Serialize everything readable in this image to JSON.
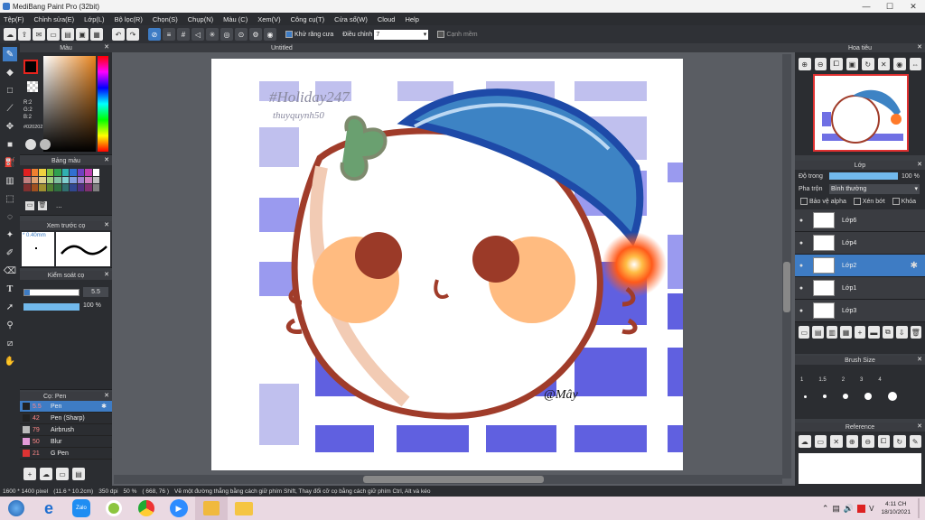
{
  "window": {
    "title": "MediBang Paint Pro (32bit)",
    "min": "—",
    "max": "☐",
    "close": "✕"
  },
  "menu": [
    "Tệp(F)",
    "Chỉnh sửa(E)",
    "Lớp(L)",
    "Bộ lọc(R)",
    "Chọn(S)",
    "Chụp(N)",
    "Màu (C)",
    "Xem(V)",
    "Công cụ(T)",
    "Cửa sổ(W)",
    "Cloud",
    "Help"
  ],
  "toolbar": {
    "antialias_label": "Khử răng cưa",
    "adjust_label": "Điều chỉnh",
    "adjust_value": "7",
    "edge_label": "Cạnh mềm"
  },
  "panels": {
    "color": {
      "title": "Màu",
      "r": "R:2",
      "g": "G:2",
      "b": "B:2",
      "hex": "#020202"
    },
    "palette": {
      "title": "Bảng màu",
      "more": "..."
    },
    "brush_preview": {
      "title": "Xem trước cọ",
      "size": "0.40mm"
    },
    "brush_control": {
      "title": "Kiểm soát cọ",
      "size": "5.5",
      "opacity": "100 %"
    },
    "brushes": {
      "title": "Cọ: Pen",
      "items": [
        {
          "size": "5.5",
          "name": "Pen",
          "color": "#222222"
        },
        {
          "size": "42",
          "name": "Pen (Sharp)",
          "color": "#222222"
        },
        {
          "size": "79",
          "name": "Airbrush",
          "color": "#bbbbbb"
        },
        {
          "size": "50",
          "name": "Blur",
          "color": "#e39ad8"
        },
        {
          "size": "21",
          "name": "G Pen",
          "color": "#dd3333"
        }
      ]
    },
    "navigator": {
      "title": "Hoa tiêu"
    },
    "layers": {
      "title": "Lớp",
      "opacity_label": "Độ trong",
      "opacity_value": "100 %",
      "blend_label": "Pha trộn",
      "blend_value": "Bình thường",
      "protect_alpha": "Bảo vệ alpha",
      "clipping": "Xén bớt",
      "lock": "Khóa",
      "items": [
        "Lớp6",
        "Lớp4",
        "Lớp2",
        "Lớp1",
        "Lớp3"
      ],
      "selected": "Lớp2"
    },
    "brush_size": {
      "title": "Brush Size",
      "values": [
        "1",
        "1.5",
        "2",
        "3",
        "4"
      ]
    },
    "reference": {
      "title": "Reference"
    }
  },
  "document": {
    "tab": "Untitled",
    "watermark": "#Holiday247",
    "watermark2": "thuyquynh50",
    "signature": "@Mây"
  },
  "status": {
    "dims": "1600 * 1400 pixel",
    "size_cm": "(11.6 * 10.2cm)",
    "dpi": "350 dpi",
    "zoom": "50 %",
    "coords": "( 668, 76 )",
    "hint": "Vẽ một đường thẳng bằng cách giữ phím Shift, Thay đổi cỡ cọ bằng cách giữ phím Ctrl, Alt và kéo"
  },
  "taskbar": {
    "time": "4:11 CH",
    "date": "18/10/2021",
    "zalo": "Zalo"
  }
}
